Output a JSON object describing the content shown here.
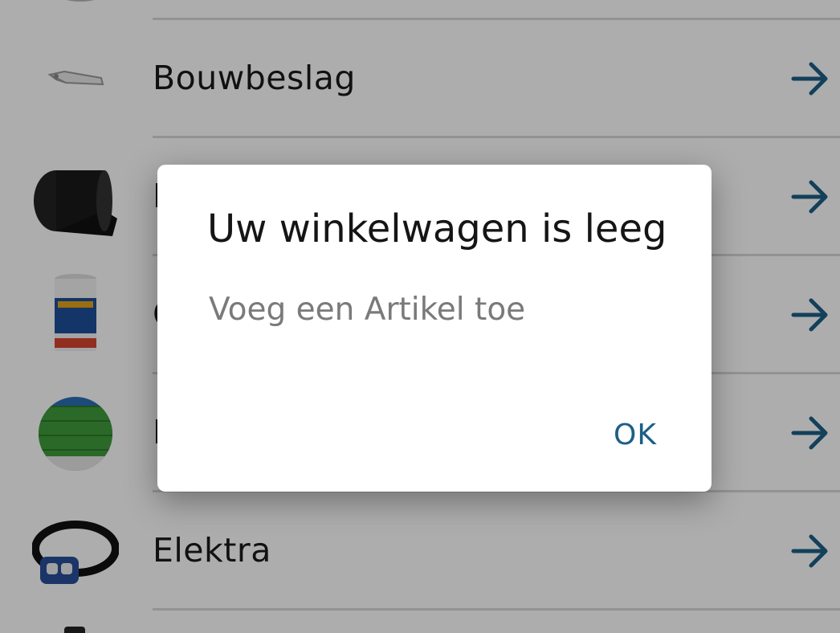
{
  "categories": [
    {
      "label": "Bouwbeslag",
      "icon": "door-hardware-icon"
    },
    {
      "label": "B",
      "icon": "roll-icon"
    },
    {
      "label": "C",
      "icon": "container-icon"
    },
    {
      "label": "D",
      "icon": "fence-panel-icon"
    },
    {
      "label": "Elektra",
      "icon": "headlamp-icon"
    }
  ],
  "dialog": {
    "title": "Uw winkelwagen is leeg",
    "message": "Voeg een Artikel toe",
    "ok_label": "OK"
  },
  "colors": {
    "accent": "#1d5f86",
    "arrow": "#1d5f86",
    "divider": "#d7d7d7"
  }
}
